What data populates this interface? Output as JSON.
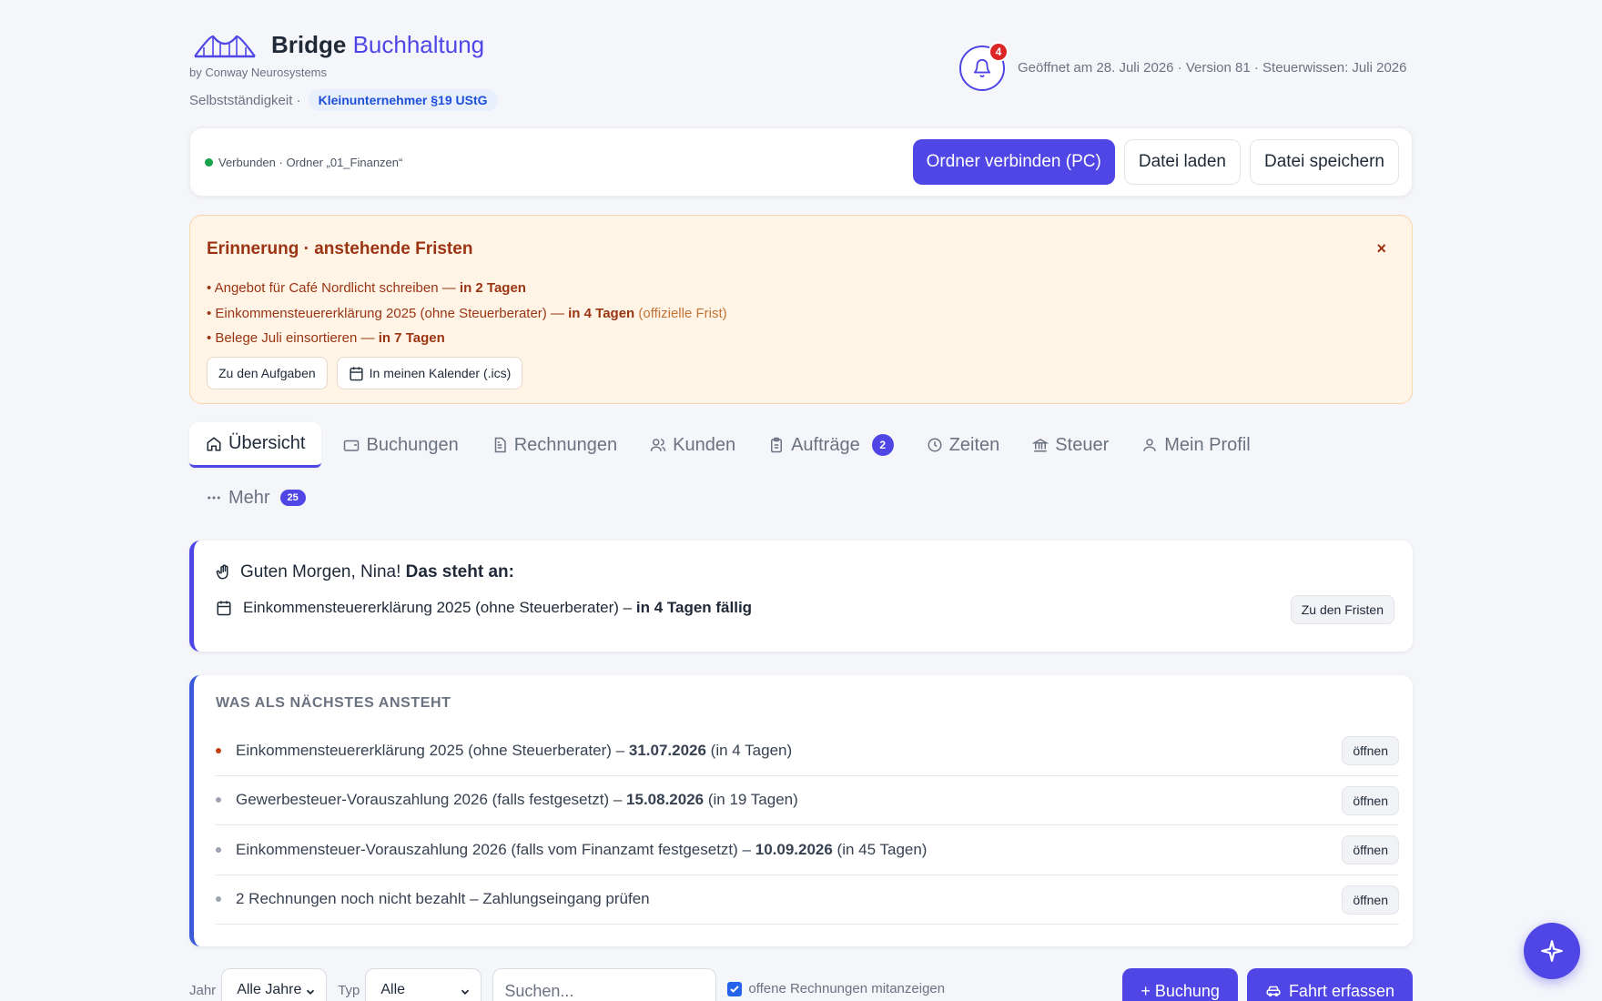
{
  "brand": {
    "name": "Bridge",
    "name_accent": "Buchhaltung",
    "byline": "by Conway Neurosystems",
    "mode_label": "Selbstständigkeit ·",
    "mode_badge": "Kleinunternehmer §19 UStG"
  },
  "header": {
    "notification_count": "4",
    "meta": "Geöffnet am 28. Juli 2026 · Version 81 · Steuerwissen: Juli 2026"
  },
  "connection": {
    "status": "Verbunden · Ordner „01_Finanzen“",
    "connect_button": "Ordner verbinden (PC)",
    "load_button": "Datei laden",
    "save_button": "Datei speichern"
  },
  "reminder": {
    "title": "Erinnerung · anstehende Fristen",
    "close": "×",
    "items": [
      {
        "text": "• Angebot für Café Nordlicht schreiben — ",
        "due": "in 2 Tagen",
        "note": ""
      },
      {
        "text": "• Einkommensteuererklärung 2025 (ohne Steuerberater) — ",
        "due": "in 4 Tagen",
        "note": " (offizielle Frist)"
      },
      {
        "text": "• Belege Juli einsortieren — ",
        "due": "in 7 Tagen",
        "note": ""
      }
    ],
    "tasks_button": "Zu den Aufgaben",
    "calendar_button": "In meinen Kalender (.ics)"
  },
  "tabs": [
    {
      "label": "Übersicht",
      "icon": "home-icon",
      "active": true
    },
    {
      "label": "Buchungen",
      "icon": "wallet-icon"
    },
    {
      "label": "Rechnungen",
      "icon": "document-icon"
    },
    {
      "label": "Kunden",
      "icon": "users-icon"
    },
    {
      "label": "Aufträge",
      "icon": "clipboard-icon",
      "badge": "2"
    },
    {
      "label": "Zeiten",
      "icon": "clock-icon"
    },
    {
      "label": "Steuer",
      "icon": "bank-icon"
    },
    {
      "label": "Mein Profil",
      "icon": "user-icon"
    }
  ],
  "more_tab": {
    "label": "Mehr",
    "badge": "25"
  },
  "greeting": {
    "text": "Guten Morgen, Nina! ",
    "bold": "Das steht an:",
    "item_text": "Einkommensteuererklärung 2025 (ohne Steuerberater) – ",
    "item_bold": "in 4 Tagen fällig",
    "button": "Zu den Fristen"
  },
  "next": {
    "title": "Was als nächstes ansteht",
    "items": [
      {
        "text": "Einkommensteuererklärung 2025 (ohne Steuerberater) – ",
        "date": "31.07.2026",
        "rel": " (in 4 Tagen)",
        "button": "öffnen"
      },
      {
        "text": "Gewerbesteuer-Vorauszahlung 2026 (falls festgesetzt) – ",
        "date": "15.08.2026",
        "rel": " (in 19 Tagen)",
        "button": "öffnen"
      },
      {
        "text": "Einkommensteuer-Vorauszahlung 2026 (falls vom Finanzamt festgesetzt) – ",
        "date": "10.09.2026",
        "rel": " (in 45 Tagen)",
        "button": "öffnen"
      },
      {
        "text": "2 Rechnungen noch nicht bezahlt – Zahlungseingang prüfen",
        "date": "",
        "rel": "",
        "button": "öffnen"
      }
    ]
  },
  "filters": {
    "year_label": "Jahr",
    "year_value": "Alle Jahre",
    "type_label": "Typ",
    "type_value": "Alle",
    "search_placeholder": "Suchen...",
    "open_invoices_label": "offene Rechnungen mitanzeigen",
    "add_booking": "+ Buchung",
    "add_trip": "Fahrt erfassen"
  },
  "colors": {
    "accent": "#4f46e5",
    "reminder_bg": "#fff4e6",
    "reminder_text": "#9a3412",
    "danger": "#dc2626",
    "success": "#16a34a"
  }
}
